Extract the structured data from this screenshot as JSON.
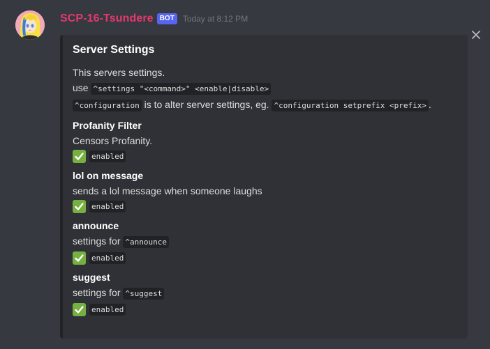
{
  "message": {
    "username": "SCP-16-Tsundere",
    "bot_tag": "BOT",
    "timestamp": "Today at 8:12 PM",
    "close_icon": "close-icon",
    "avatar_icon": "anime-avatar"
  },
  "embed": {
    "title": "Server Settings",
    "description": {
      "line1": "This servers settings.",
      "use_word": "use",
      "code_settings": "^settings \"<command>\" <enable|disable>",
      "code_configuration": "^configuration",
      "middle_text": "is to alter server settings, eg.",
      "code_example": "^configuration setprefix <prefix>",
      "end_period": "."
    },
    "fields": [
      {
        "name": "Profanity Filter",
        "value_text": "Censors Profanity.",
        "value_code": "",
        "status_icon": "check-mark-icon",
        "status": "enabled"
      },
      {
        "name": "lol on message",
        "value_text": "sends a lol message when someone laughs",
        "value_code": "",
        "status_icon": "check-mark-icon",
        "status": "enabled"
      },
      {
        "name": "announce",
        "value_text": "settings for",
        "value_code": "^announce",
        "status_icon": "check-mark-icon",
        "status": "enabled"
      },
      {
        "name": "suggest",
        "value_text": "settings for",
        "value_code": "^suggest",
        "status_icon": "check-mark-icon",
        "status": "enabled"
      }
    ]
  },
  "colors": {
    "background": "#36393f",
    "embed_bg": "#2f3136",
    "username": "#e5386d",
    "bot_tag": "#5865f2",
    "check_green": "#76b041"
  }
}
